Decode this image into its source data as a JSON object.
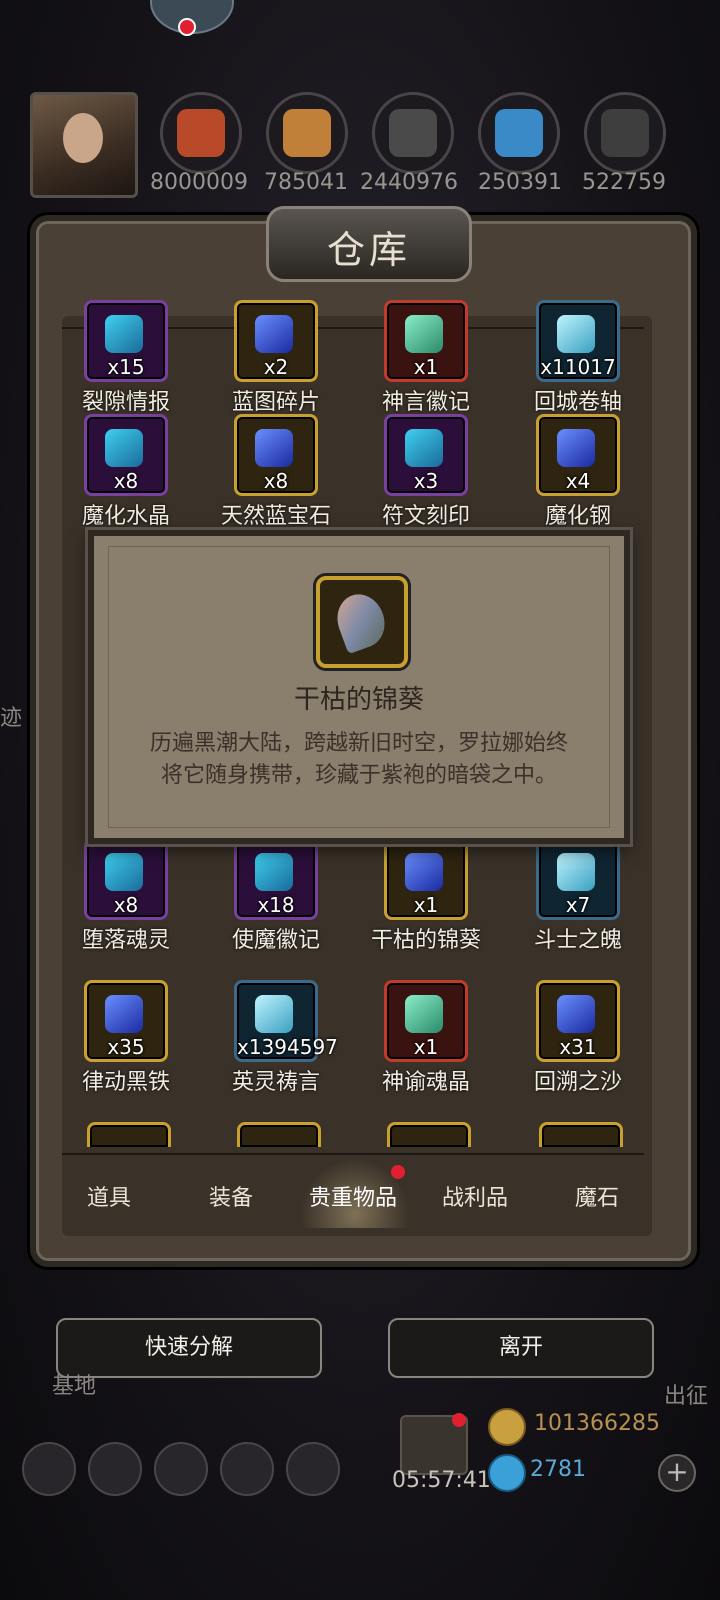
{
  "resources": [
    {
      "name": "ore-red",
      "value": "8000009",
      "color": "#b84a2a"
    },
    {
      "name": "wood",
      "value": "785041",
      "color": "#c0803a"
    },
    {
      "name": "stone",
      "value": "2440976",
      "color": "#4a4a4a"
    },
    {
      "name": "crystal",
      "value": "250391",
      "color": "#3a8ac8"
    },
    {
      "name": "iron",
      "value": "522759",
      "color": "#3e3e3e"
    }
  ],
  "panel": {
    "title": "仓库"
  },
  "items": [
    {
      "name": "裂隙情报",
      "qty": "x15",
      "frame": "purple"
    },
    {
      "name": "蓝图碎片",
      "qty": "x2",
      "frame": "gold"
    },
    {
      "name": "神言徽记",
      "qty": "x1",
      "frame": "red"
    },
    {
      "name": "回城卷轴",
      "qty": "x11017",
      "frame": "blue"
    },
    {
      "name": "魔化水晶",
      "qty": "x8",
      "frame": "purple"
    },
    {
      "name": "天然蓝宝石",
      "qty": "x8",
      "frame": "gold"
    },
    {
      "name": "符文刻印",
      "qty": "x3",
      "frame": "purple"
    },
    {
      "name": "魔化钢",
      "qty": "x4",
      "frame": "gold"
    },
    {
      "name": "堕落魂灵",
      "qty": "x8",
      "frame": "purple"
    },
    {
      "name": "使魔徽记",
      "qty": "x18",
      "frame": "purple"
    },
    {
      "name": "干枯的锦葵",
      "qty": "x1",
      "frame": "gold"
    },
    {
      "name": "斗士之魄",
      "qty": "x7",
      "frame": "blue"
    },
    {
      "name": "律动黑铁",
      "qty": "x35",
      "frame": "gold"
    },
    {
      "name": "英灵祷言",
      "qty": "x1394597",
      "frame": "blue"
    },
    {
      "name": "神谕魂晶",
      "qty": "x1",
      "frame": "red"
    },
    {
      "name": "回溯之沙",
      "qty": "x31",
      "frame": "gold"
    }
  ],
  "popup": {
    "name": "干枯的锦葵",
    "desc_line1": "历遍黑潮大陆，跨越新旧时空，罗拉娜始终",
    "desc_line2": "将它随身携带，珍藏于紫袍的暗袋之中。"
  },
  "tabs": [
    {
      "label": "道具"
    },
    {
      "label": "装备"
    },
    {
      "label": "贵重物品",
      "active": true
    },
    {
      "label": "战利品"
    },
    {
      "label": "魔石"
    }
  ],
  "buttons": {
    "decompose": "快速分解",
    "leave": "离开"
  },
  "bottom": {
    "timer": "05:57:41",
    "gold": "101366285",
    "gems": "2781",
    "plus": "+",
    "left_fragment": "基地",
    "right_fragment": "出征",
    "side_fragment": "迹"
  }
}
